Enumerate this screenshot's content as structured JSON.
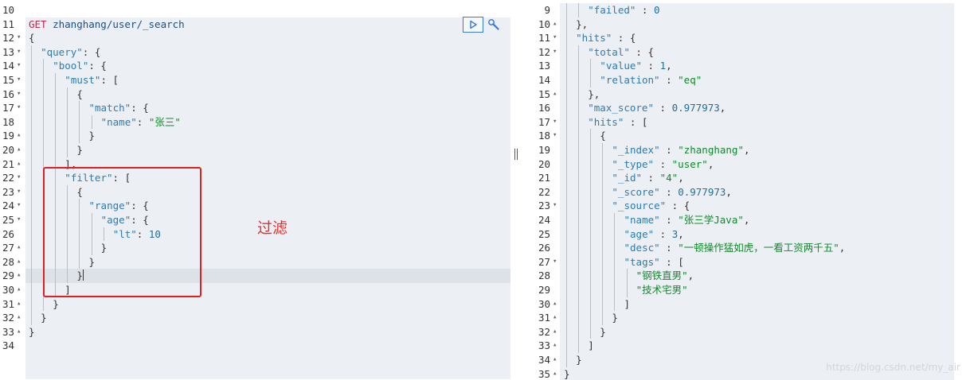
{
  "request_panel": {
    "lines": [
      {
        "num": "10",
        "fold": "",
        "indent": 0,
        "tokens": []
      },
      {
        "num": "11",
        "fold": "",
        "indent": 0,
        "tokens": [
          {
            "t": "GET",
            "c": "m"
          },
          {
            "t": " zhanghang/user/_search",
            "c": "u"
          }
        ]
      },
      {
        "num": "12",
        "fold": "▾",
        "indent": 0,
        "tokens": [
          {
            "t": "{",
            "c": "p"
          }
        ]
      },
      {
        "num": "13",
        "fold": "▾",
        "indent": 2,
        "tokens": [
          {
            "t": "\"query\"",
            "c": "k"
          },
          {
            "t": ": {",
            "c": "p"
          }
        ]
      },
      {
        "num": "14",
        "fold": "▾",
        "indent": 4,
        "tokens": [
          {
            "t": "\"bool\"",
            "c": "k"
          },
          {
            "t": ": {",
            "c": "p"
          }
        ]
      },
      {
        "num": "15",
        "fold": "▾",
        "indent": 6,
        "tokens": [
          {
            "t": "\"must\"",
            "c": "k"
          },
          {
            "t": ": [",
            "c": "p"
          }
        ]
      },
      {
        "num": "16",
        "fold": "▾",
        "indent": 8,
        "tokens": [
          {
            "t": "{",
            "c": "p"
          }
        ]
      },
      {
        "num": "17",
        "fold": "▾",
        "indent": 10,
        "tokens": [
          {
            "t": "\"match\"",
            "c": "k"
          },
          {
            "t": ": {",
            "c": "p"
          }
        ]
      },
      {
        "num": "18",
        "fold": "",
        "indent": 12,
        "tokens": [
          {
            "t": "\"name\"",
            "c": "k"
          },
          {
            "t": ": ",
            "c": "p"
          },
          {
            "t": "\"张三\"",
            "c": "s"
          }
        ]
      },
      {
        "num": "19",
        "fold": "▴",
        "indent": 10,
        "tokens": [
          {
            "t": "}",
            "c": "p"
          }
        ]
      },
      {
        "num": "20",
        "fold": "▴",
        "indent": 8,
        "tokens": [
          {
            "t": "}",
            "c": "p"
          }
        ]
      },
      {
        "num": "21",
        "fold": "▴",
        "indent": 6,
        "tokens": [
          {
            "t": "],",
            "c": "p"
          }
        ]
      },
      {
        "num": "22",
        "fold": "▾",
        "indent": 6,
        "tokens": [
          {
            "t": "\"filter\"",
            "c": "k"
          },
          {
            "t": ": [",
            "c": "p"
          }
        ]
      },
      {
        "num": "23",
        "fold": "▾",
        "indent": 8,
        "tokens": [
          {
            "t": "{",
            "c": "p"
          }
        ]
      },
      {
        "num": "24",
        "fold": "▾",
        "indent": 10,
        "tokens": [
          {
            "t": "\"range\"",
            "c": "k"
          },
          {
            "t": ": {",
            "c": "p"
          }
        ]
      },
      {
        "num": "25",
        "fold": "▾",
        "indent": 12,
        "tokens": [
          {
            "t": "\"age\"",
            "c": "k"
          },
          {
            "t": ": {",
            "c": "p"
          }
        ]
      },
      {
        "num": "26",
        "fold": "",
        "indent": 14,
        "tokens": [
          {
            "t": "\"lt\"",
            "c": "k"
          },
          {
            "t": ": ",
            "c": "p"
          },
          {
            "t": "10",
            "c": "n"
          }
        ]
      },
      {
        "num": "27",
        "fold": "▴",
        "indent": 12,
        "tokens": [
          {
            "t": "}",
            "c": "p"
          }
        ]
      },
      {
        "num": "28",
        "fold": "▴",
        "indent": 10,
        "tokens": [
          {
            "t": "}",
            "c": "p"
          }
        ]
      },
      {
        "num": "29",
        "fold": "▴",
        "indent": 8,
        "tokens": [
          {
            "t": "}",
            "c": "p"
          },
          {
            "cursor": true
          }
        ]
      },
      {
        "num": "30",
        "fold": "▴",
        "indent": 6,
        "tokens": [
          {
            "t": "]",
            "c": "p"
          }
        ]
      },
      {
        "num": "31",
        "fold": "▴",
        "indent": 4,
        "tokens": [
          {
            "t": "}",
            "c": "p"
          }
        ]
      },
      {
        "num": "32",
        "fold": "▴",
        "indent": 2,
        "tokens": [
          {
            "t": "}",
            "c": "p"
          }
        ]
      },
      {
        "num": "33",
        "fold": "▴",
        "indent": 0,
        "tokens": [
          {
            "t": "}",
            "c": "p"
          }
        ]
      },
      {
        "num": "34",
        "fold": "",
        "indent": 0,
        "tokens": []
      }
    ]
  },
  "response_panel": {
    "lines": [
      {
        "num": "9",
        "fold": "",
        "indent": 4,
        "tokens": [
          {
            "t": "\"failed\"",
            "c": "k"
          },
          {
            "t": " : ",
            "c": "p"
          },
          {
            "t": "0",
            "c": "n"
          }
        ]
      },
      {
        "num": "10",
        "fold": "▴",
        "indent": 2,
        "tokens": [
          {
            "t": "},",
            "c": "p"
          }
        ]
      },
      {
        "num": "11",
        "fold": "▾",
        "indent": 2,
        "tokens": [
          {
            "t": "\"hits\"",
            "c": "k"
          },
          {
            "t": " : {",
            "c": "p"
          }
        ]
      },
      {
        "num": "12",
        "fold": "▾",
        "indent": 4,
        "tokens": [
          {
            "t": "\"total\"",
            "c": "k"
          },
          {
            "t": " : {",
            "c": "p"
          }
        ]
      },
      {
        "num": "13",
        "fold": "",
        "indent": 6,
        "tokens": [
          {
            "t": "\"value\"",
            "c": "k"
          },
          {
            "t": " : ",
            "c": "p"
          },
          {
            "t": "1",
            "c": "n"
          },
          {
            "t": ",",
            "c": "p"
          }
        ]
      },
      {
        "num": "14",
        "fold": "",
        "indent": 6,
        "tokens": [
          {
            "t": "\"relation\"",
            "c": "k"
          },
          {
            "t": " : ",
            "c": "p"
          },
          {
            "t": "\"eq\"",
            "c": "s"
          }
        ]
      },
      {
        "num": "15",
        "fold": "▴",
        "indent": 4,
        "tokens": [
          {
            "t": "},",
            "c": "p"
          }
        ]
      },
      {
        "num": "16",
        "fold": "",
        "indent": 4,
        "tokens": [
          {
            "t": "\"max_score\"",
            "c": "k"
          },
          {
            "t": " : ",
            "c": "p"
          },
          {
            "t": "0.977973",
            "c": "n"
          },
          {
            "t": ",",
            "c": "p"
          }
        ]
      },
      {
        "num": "17",
        "fold": "▾",
        "indent": 4,
        "tokens": [
          {
            "t": "\"hits\"",
            "c": "k"
          },
          {
            "t": " : [",
            "c": "p"
          }
        ]
      },
      {
        "num": "18",
        "fold": "▾",
        "indent": 6,
        "tokens": [
          {
            "t": "{",
            "c": "p"
          }
        ]
      },
      {
        "num": "19",
        "fold": "",
        "indent": 8,
        "tokens": [
          {
            "t": "\"_index\"",
            "c": "k"
          },
          {
            "t": " : ",
            "c": "p"
          },
          {
            "t": "\"zhanghang\"",
            "c": "s"
          },
          {
            "t": ",",
            "c": "p"
          }
        ]
      },
      {
        "num": "20",
        "fold": "",
        "indent": 8,
        "tokens": [
          {
            "t": "\"_type\"",
            "c": "k"
          },
          {
            "t": " : ",
            "c": "p"
          },
          {
            "t": "\"user\"",
            "c": "s"
          },
          {
            "t": ",",
            "c": "p"
          }
        ]
      },
      {
        "num": "21",
        "fold": "",
        "indent": 8,
        "tokens": [
          {
            "t": "\"_id\"",
            "c": "k"
          },
          {
            "t": " : ",
            "c": "p"
          },
          {
            "t": "\"4\"",
            "c": "s"
          },
          {
            "t": ",",
            "c": "p"
          }
        ]
      },
      {
        "num": "22",
        "fold": "",
        "indent": 8,
        "tokens": [
          {
            "t": "\"_score\"",
            "c": "k"
          },
          {
            "t": " : ",
            "c": "p"
          },
          {
            "t": "0.977973",
            "c": "n"
          },
          {
            "t": ",",
            "c": "p"
          }
        ]
      },
      {
        "num": "23",
        "fold": "▾",
        "indent": 8,
        "tokens": [
          {
            "t": "\"_source\"",
            "c": "k"
          },
          {
            "t": " : {",
            "c": "p"
          }
        ]
      },
      {
        "num": "24",
        "fold": "",
        "indent": 10,
        "tokens": [
          {
            "t": "\"name\"",
            "c": "k"
          },
          {
            "t": " : ",
            "c": "p"
          },
          {
            "t": "\"张三学Java\"",
            "c": "s"
          },
          {
            "t": ",",
            "c": "p"
          }
        ]
      },
      {
        "num": "25",
        "fold": "",
        "indent": 10,
        "tokens": [
          {
            "t": "\"age\"",
            "c": "k"
          },
          {
            "t": " : ",
            "c": "p"
          },
          {
            "t": "3",
            "c": "n"
          },
          {
            "t": ",",
            "c": "p"
          }
        ]
      },
      {
        "num": "26",
        "fold": "",
        "indent": 10,
        "tokens": [
          {
            "t": "\"desc\"",
            "c": "k"
          },
          {
            "t": " : ",
            "c": "p"
          },
          {
            "t": "\"一顿操作猛如虎，一看工资两千五\"",
            "c": "s"
          },
          {
            "t": ",",
            "c": "p"
          }
        ]
      },
      {
        "num": "27",
        "fold": "▾",
        "indent": 10,
        "tokens": [
          {
            "t": "\"tags\"",
            "c": "k"
          },
          {
            "t": " : [",
            "c": "p"
          }
        ]
      },
      {
        "num": "28",
        "fold": "",
        "indent": 12,
        "tokens": [
          {
            "t": "\"钢铁直男\"",
            "c": "s"
          },
          {
            "t": ",",
            "c": "p"
          }
        ]
      },
      {
        "num": "29",
        "fold": "",
        "indent": 12,
        "tokens": [
          {
            "t": "\"技术宅男\"",
            "c": "s"
          }
        ]
      },
      {
        "num": "30",
        "fold": "▴",
        "indent": 10,
        "tokens": [
          {
            "t": "]",
            "c": "p"
          }
        ]
      },
      {
        "num": "31",
        "fold": "▴",
        "indent": 8,
        "tokens": [
          {
            "t": "}",
            "c": "p"
          }
        ]
      },
      {
        "num": "32",
        "fold": "▴",
        "indent": 6,
        "tokens": [
          {
            "t": "}",
            "c": "p"
          }
        ]
      },
      {
        "num": "33",
        "fold": "▴",
        "indent": 4,
        "tokens": [
          {
            "t": "]",
            "c": "p"
          }
        ]
      },
      {
        "num": "34",
        "fold": "▴",
        "indent": 2,
        "tokens": [
          {
            "t": "}",
            "c": "p"
          }
        ]
      },
      {
        "num": "35",
        "fold": "▴",
        "indent": 0,
        "tokens": [
          {
            "t": "}",
            "c": "p"
          }
        ]
      }
    ]
  },
  "annotation": {
    "text": "过滤",
    "color": "#e53030"
  },
  "watermark": {
    "text": "https://blog.csdn.net/my_air"
  },
  "colors": {
    "accent": "#3a7bd5",
    "highlight_box": "#e02020"
  },
  "icons": {
    "run": "play-icon",
    "settings": "wrench-icon"
  }
}
